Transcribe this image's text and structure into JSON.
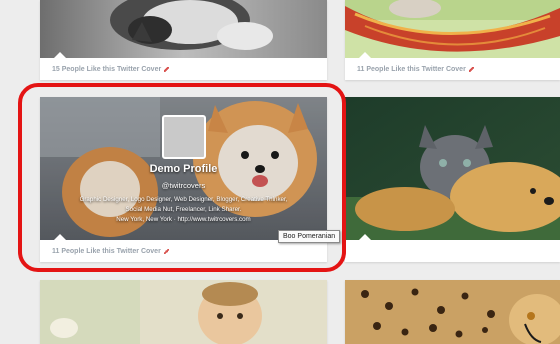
{
  "cards": {
    "top_left_caption": "15 People Like this Twitter Cover",
    "top_right_caption": "11 People Like this Twitter Cover",
    "mid_left_caption": "11 People Like this Twitter Cover",
    "mid_right_caption": ""
  },
  "profile": {
    "name": "Demo Profile",
    "handle": "@twitrcovers",
    "bio_line1": "Graphic Designer, Logo Designer, Web Designer, Blogger, Creative Thinker,",
    "bio_line2": "Social Media Nut, Freelancer, Link Sharer.",
    "location": "New York, New York · http://www.twitrcovers.com"
  },
  "tooltip": "Boo Pomeranian",
  "colors": {
    "highlight": "#e41414",
    "caption_text": "#9aa3ad",
    "background": "#ededed"
  }
}
